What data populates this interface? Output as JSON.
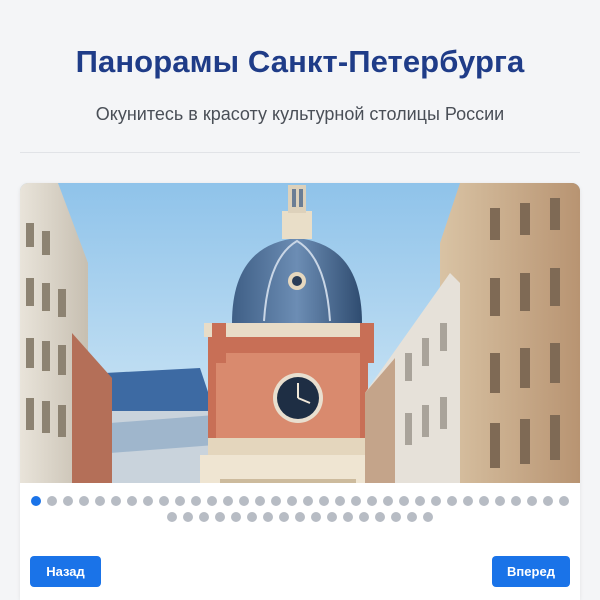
{
  "header": {
    "title": "Панорамы Санкт-Петербурга",
    "subtitle": "Окунитесь в красоту культурной столицы России"
  },
  "gallery": {
    "image_description": "Clock tower with blue dome between classical facades",
    "slide_count": 51,
    "active_index": 0
  },
  "controls": {
    "prev_label": "Назад",
    "next_label": "Вперед"
  },
  "colors": {
    "title": "#1f3c88",
    "accent": "#1a73e8",
    "dot_inactive": "#b7bcc4"
  }
}
